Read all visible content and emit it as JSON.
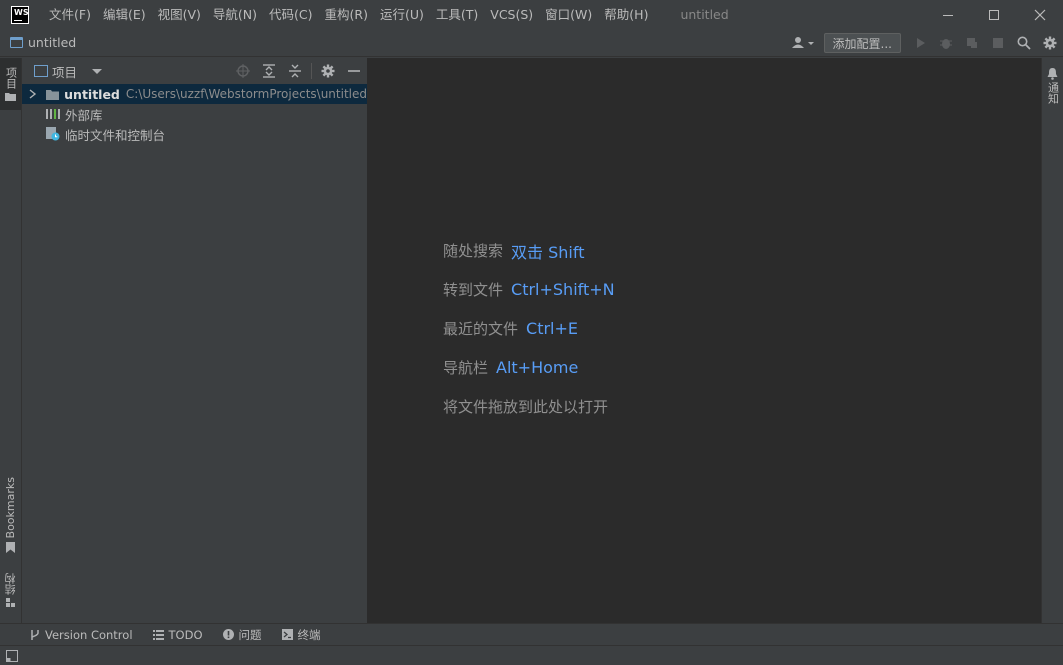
{
  "app": {
    "logo_text": "WS",
    "window_title": "untitled"
  },
  "menu": [
    "文件(F)",
    "编辑(E)",
    "视图(V)",
    "导航(N)",
    "代码(C)",
    "重构(R)",
    "运行(U)",
    "工具(T)",
    "VCS(S)",
    "窗口(W)",
    "帮助(H)"
  ],
  "navbar": {
    "crumb": "untitled",
    "add_config_label": "添加配置..."
  },
  "left_strip": {
    "project_tab": "项目",
    "bookmarks_tab": "Bookmarks",
    "structure_tab": "结构"
  },
  "right_strip": {
    "notifications_tab": "通知"
  },
  "project_panel": {
    "title": "项目",
    "tree": [
      {
        "name": "untitled",
        "path": "C:\\Users\\uzzf\\WebstormProjects\\untitled"
      },
      {
        "name": "外部库"
      },
      {
        "name": "临时文件和控制台"
      }
    ]
  },
  "editor": {
    "hints": [
      {
        "label": "随处搜索",
        "key": "双击 Shift"
      },
      {
        "label": "转到文件",
        "key": "Ctrl+Shift+N"
      },
      {
        "label": "最近的文件",
        "key": "Ctrl+E"
      },
      {
        "label": "导航栏",
        "key": "Alt+Home"
      },
      {
        "label": "将文件拖放到此处以打开",
        "key": ""
      }
    ]
  },
  "bottom_tools": {
    "version_control": "Version Control",
    "todo": "TODO",
    "problems": "问题",
    "terminal": "终端"
  },
  "colors": {
    "accent": "#589df6",
    "editor_bg": "#2b2b2b",
    "panel_bg": "#3c3f41",
    "selection": "#0d293e"
  }
}
